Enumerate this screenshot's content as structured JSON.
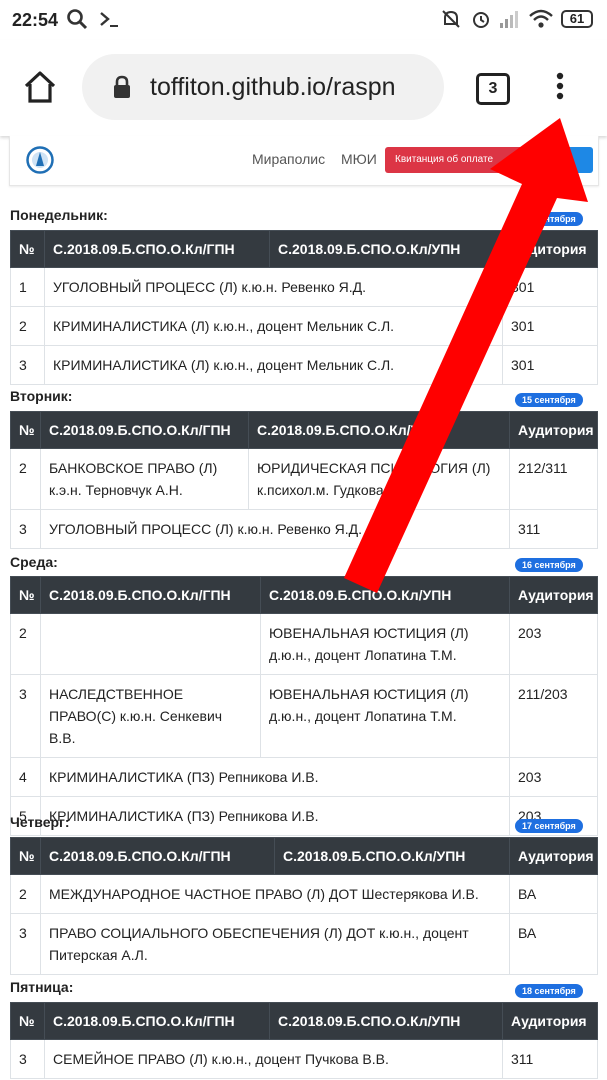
{
  "status_bar": {
    "time": "22:54",
    "battery": "61"
  },
  "browser": {
    "url": "toffiton.github.io/raspn",
    "tab_count": "3"
  },
  "site_nav": {
    "link1": "Мираполис",
    "link2": "МЮИ",
    "receipt": "Квитанция об оплате"
  },
  "headers": {
    "num": "№",
    "group1": "С.2018.09.Б.СПО.О.Кл/ГПН",
    "group2": "С.2018.09.Б.СПО.О.Кл/УПН",
    "room": "Аудитория"
  },
  "days": {
    "mon": {
      "title": "Понедельник:",
      "date": "14 сентября",
      "rows": [
        {
          "num": "1",
          "text": "УГОЛОВНЫЙ ПРОЦЕСС (Л) к.ю.н. Ревенко Я.Д.",
          "room": "301"
        },
        {
          "num": "2",
          "text": "КРИМИНАЛИСТИКА (Л) к.ю.н., доцент Мельник С.Л.",
          "room": "301"
        },
        {
          "num": "3",
          "text": "КРИМИНАЛИСТИКА (Л) к.ю.н., доцент Мельник С.Л.",
          "room": "301"
        }
      ]
    },
    "tue": {
      "title": "Вторник:",
      "date": "15 сентября",
      "rows": [
        {
          "num": "2",
          "left": "БАНКОВСКОЕ ПРАВО (Л) к.э.н. Терновчук А.Н.",
          "right": "ЮРИДИЧЕСКАЯ ПСИХОЛОГИЯ (Л) к.психол.м. Гудкова И.Ю.",
          "room": "212/311"
        },
        {
          "num": "3",
          "text": "УГОЛОВНЫЙ ПРОЦЕСС (Л) к.ю.н. Ревенко Я.Д.",
          "room": "311"
        }
      ]
    },
    "wed": {
      "title": "Среда:",
      "date": "16 сентября",
      "rows": [
        {
          "num": "2",
          "left": "",
          "right": "ЮВЕНАЛЬНАЯ ЮСТИЦИЯ (Л) д.ю.н., доцент Лопатина Т.М.",
          "room": "203"
        },
        {
          "num": "3",
          "left": "НАСЛЕДСТВЕННОЕ ПРАВО(С) к.ю.н. Сенкевич В.В.",
          "right": "ЮВЕНАЛЬНАЯ ЮСТИЦИЯ (Л) д.ю.н., доцент Лопатина Т.М.",
          "room": "211/203"
        },
        {
          "num": "4",
          "text": "КРИМИНАЛИСТИКА (ПЗ) Репникова И.В.",
          "room": "203"
        },
        {
          "num": "5",
          "text": "КРИМИНАЛИСТИКА (ПЗ) Репникова И.В.",
          "room": "203"
        }
      ]
    },
    "thu": {
      "title": "Четверг:",
      "date": "17 сентября",
      "rows": [
        {
          "num": "2",
          "text": "МЕЖДУНАРОДНОЕ ЧАСТНОЕ ПРАВО (Л) ДОТ Шестерякова И.В.",
          "room": "ВА"
        },
        {
          "num": "3",
          "text": "ПРАВО СОЦИАЛЬНОГО ОБЕСПЕЧЕНИЯ (Л) ДОТ к.ю.н., доцент Питерская А.Л.",
          "room": "ВА"
        }
      ]
    },
    "fri": {
      "title": "Пятница:",
      "date": "18 сентября",
      "rows": [
        {
          "num": "3",
          "text": "СЕМЕЙНОЕ ПРАВО (Л) к.ю.н., доцент Пучкова В.В.",
          "room": "311"
        }
      ]
    }
  },
  "colors": {
    "header_bg": "#343a40",
    "badge": "#1e6fe0",
    "receipt": "#dc3545",
    "arrow": "#ff0000"
  }
}
